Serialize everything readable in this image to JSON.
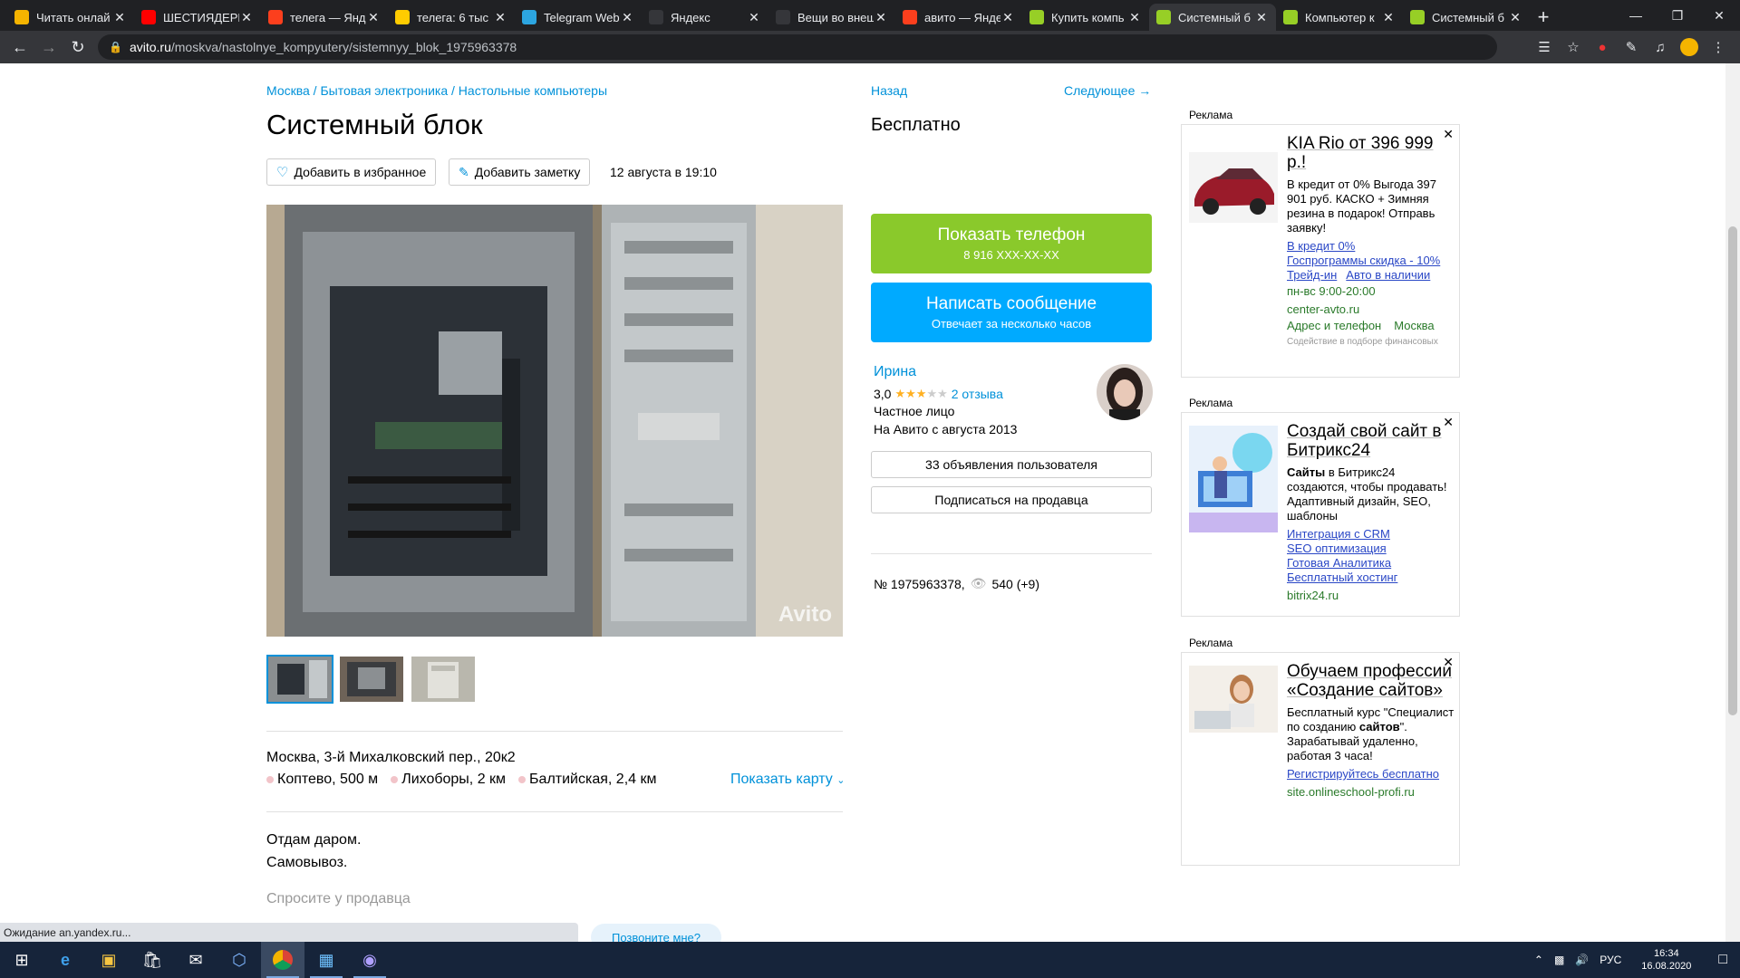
{
  "browser": {
    "tabs": [
      {
        "label": "Читать онлай",
        "icon": "b-icon",
        "color": "#f5b400"
      },
      {
        "label": "ШЕСТИЯДЕРН",
        "icon": "youtube-icon",
        "color": "#ff0000"
      },
      {
        "label": "телега — Янд",
        "icon": "yandex-icon",
        "color": "#fc3f1d"
      },
      {
        "label": "телега: 6 тыс",
        "icon": "yandex-images-icon",
        "color": "#ffcc00"
      },
      {
        "label": "Telegram Web",
        "icon": "telegram-icon",
        "color": "#2ca5e0"
      },
      {
        "label": "Яндекс",
        "icon": "blank-icon",
        "color": "#35363a"
      },
      {
        "label": "Вещи во внеш",
        "icon": "plus-icon",
        "color": "#35363a"
      },
      {
        "label": "авито — Янде",
        "icon": "yandex-icon",
        "color": "#fc3f1d"
      },
      {
        "label": "Купить компь",
        "icon": "avito-icon",
        "color": "#97cf26"
      },
      {
        "label": "Системный б",
        "icon": "avito-icon",
        "color": "#97cf26",
        "active": true
      },
      {
        "label": "Компьютер к",
        "icon": "avito-icon",
        "color": "#97cf26"
      },
      {
        "label": "Системный б",
        "icon": "avito-icon",
        "color": "#97cf26"
      }
    ],
    "url_host": "avito.ru",
    "url_path": "/moskva/nastolnye_kompyutery/sistemnyy_blok_1975963378",
    "status_text": "Ожидание an.yandex.ru..."
  },
  "listing": {
    "breadcrumb": "Москва / Бытовая электроника / Настольные компьютеры",
    "title": "Системный блок",
    "fav_label": "Добавить в избранное",
    "note_label": "Добавить заметку",
    "date": "12 августа в 19:10",
    "address": "Москва, 3-й Михалковский пер., 20к2",
    "metro": [
      "Коптево, 500 м",
      "Лихоборы, 2 км",
      "Балтийская, 2,4 км"
    ],
    "show_map": "Показать карту",
    "description": [
      "Отдам даром.",
      "Самовывоз."
    ],
    "ask_seller": "Спросите у продавца",
    "ask_button": "Позвоните мне?",
    "watermark": "Avito"
  },
  "sidebar": {
    "back": "Назад",
    "next": "Следующее →",
    "price": "Бесплатно",
    "call_label": "Показать телефон",
    "call_phone": "8 916 XXX-XX-XX",
    "msg_label": "Написать сообщение",
    "msg_sub": "Отвечает за несколько часов",
    "seller_name": "Ирина",
    "rating": "3,0",
    "stars": 3,
    "reviews": "2 отзыва",
    "seller_type": "Частное лицо",
    "seller_since": "На Авито с августа 2013",
    "ads_count": "33 объявления пользователя",
    "subscribe": "Подписаться на продавца",
    "item_id": "№ 1975963378,",
    "views": "540 (+9)"
  },
  "ads": [
    {
      "label": "Реклама",
      "title": "KIA Rio от 396 999 р.!",
      "text": "В кредит от 0% Выгода 397 901 руб. КАСКО + Зимняя резина в подарок! Отправь заявку!",
      "links": [
        "В кредит 0%",
        "Госпрограммы скидка - 10%",
        "Трейд-ин",
        "Авто в наличии"
      ],
      "hours": "пн-вс 9:00-20:00",
      "domain": "center-avto.ru",
      "extra": [
        "Адрес и телефон",
        "Москва"
      ],
      "small": "Содействие в подборе финансовых"
    },
    {
      "label": "Реклама",
      "title": "Создай свой сайт в Битрикс24",
      "text_bold": "Сайты",
      "text": " в Битрикс24 создаются, чтобы продавать! Адаптивный дизайн, SEO, шаблоны",
      "links": [
        "Интеграция с CRM",
        "SEO оптимизация",
        "Готовая Аналитика",
        "Бесплатный хостинг"
      ],
      "domain": "bitrix24.ru"
    },
    {
      "label": "Реклама",
      "title": "Обучаем профессии «Создание сайтов»",
      "text_a": "Бесплатный курс \"Специалист по созданию ",
      "text_bold": "сайтов",
      "text_b": "\". Зарабатывай удаленно, работая 3 часа!",
      "links": [
        "Регистрируйтесь бесплатно"
      ],
      "domain": "site.onlineschool-profi.ru"
    }
  ],
  "taskbar": {
    "lang": "РУС",
    "time": "16:34",
    "date": "16.08.2020"
  }
}
